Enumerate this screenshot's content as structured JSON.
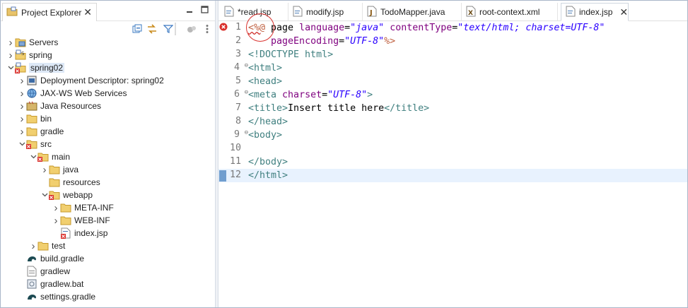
{
  "explorer": {
    "title": "Project Explorer",
    "tree": [
      {
        "label": "Servers",
        "depth": 0,
        "chev": "right",
        "icon": "folder-server-icon"
      },
      {
        "label": "spring",
        "depth": 0,
        "chev": "right",
        "icon": "project-icon"
      },
      {
        "label": "spring02",
        "depth": 0,
        "chev": "down",
        "icon": "project-error-icon",
        "selected": true
      },
      {
        "label": "Deployment Descriptor: spring02",
        "depth": 1,
        "chev": "right",
        "icon": "descriptor-icon"
      },
      {
        "label": "JAX-WS Web Services",
        "depth": 1,
        "chev": "right",
        "icon": "webservice-icon"
      },
      {
        "label": "Java Resources",
        "depth": 1,
        "chev": "right",
        "icon": "java-resources-icon"
      },
      {
        "label": "bin",
        "depth": 1,
        "chev": "right",
        "icon": "folder-icon"
      },
      {
        "label": "gradle",
        "depth": 1,
        "chev": "right",
        "icon": "folder-icon"
      },
      {
        "label": "src",
        "depth": 1,
        "chev": "down",
        "icon": "folder-error-icon"
      },
      {
        "label": "main",
        "depth": 2,
        "chev": "down",
        "icon": "folder-error-icon"
      },
      {
        "label": "java",
        "depth": 3,
        "chev": "right",
        "icon": "folder-icon"
      },
      {
        "label": "resources",
        "depth": 3,
        "chev": "none",
        "icon": "folder-icon"
      },
      {
        "label": "webapp",
        "depth": 3,
        "chev": "down",
        "icon": "folder-error-icon"
      },
      {
        "label": "META-INF",
        "depth": 4,
        "chev": "right",
        "icon": "folder-icon"
      },
      {
        "label": "WEB-INF",
        "depth": 4,
        "chev": "right",
        "icon": "folder-icon"
      },
      {
        "label": "index.jsp",
        "depth": 4,
        "chev": "none",
        "icon": "jsp-file-error-icon"
      },
      {
        "label": "test",
        "depth": 2,
        "chev": "right",
        "icon": "folder-icon"
      },
      {
        "label": "build.gradle",
        "depth": 1,
        "chev": "none",
        "icon": "gradle-icon"
      },
      {
        "label": "gradlew",
        "depth": 1,
        "chev": "none",
        "icon": "text-file-icon"
      },
      {
        "label": "gradlew.bat",
        "depth": 1,
        "chev": "none",
        "icon": "bat-file-icon"
      },
      {
        "label": "settings.gradle",
        "depth": 1,
        "chev": "none",
        "icon": "gradle-icon"
      }
    ]
  },
  "editor": {
    "tabs": [
      {
        "label": "*read.jsp",
        "icon": "jsp-tab-icon"
      },
      {
        "label": "modify.jsp",
        "icon": "jsp-tab-icon"
      },
      {
        "label": "TodoMapper.java",
        "icon": "java-tab-icon"
      },
      {
        "label": "root-context.xml",
        "icon": "xml-tab-icon"
      },
      {
        "label": "index.jsp",
        "icon": "jsp-tab-icon",
        "active": true
      }
    ],
    "lines": [
      {
        "n": "1"
      },
      {
        "n": "2"
      },
      {
        "n": "3"
      },
      {
        "n": "4"
      },
      {
        "n": "5"
      },
      {
        "n": "6"
      },
      {
        "n": "7"
      },
      {
        "n": "8"
      },
      {
        "n": "9"
      },
      {
        "n": "10"
      },
      {
        "n": "11"
      },
      {
        "n": "12"
      }
    ],
    "code": {
      "l1_open": "<%@",
      "l1_page": " page ",
      "l1_lang_attr": "language",
      "l1_eq": "=",
      "l1_lang_val": "\"java\"",
      "l1_ct_attr": "contentType",
      "l1_ct_val": "\"text/html; charset=UTF-8\"",
      "l2_pe_attr": "pageEncoding",
      "l2_pe_val": "\"UTF-8\"",
      "l2_close": "%>",
      "l3": "<!DOCTYPE html>",
      "l4": "<html>",
      "l5": "<head>",
      "l6_open": "<meta",
      "l6_attr": "charset",
      "l6_val": "\"UTF-8\"",
      "l6_close": ">",
      "l7_open": "<title>",
      "l7_text": "Insert title here",
      "l7_close": "</title>",
      "l8": "</head>",
      "l9": "<body>",
      "l11": "</body>",
      "l12": "</html>"
    }
  }
}
